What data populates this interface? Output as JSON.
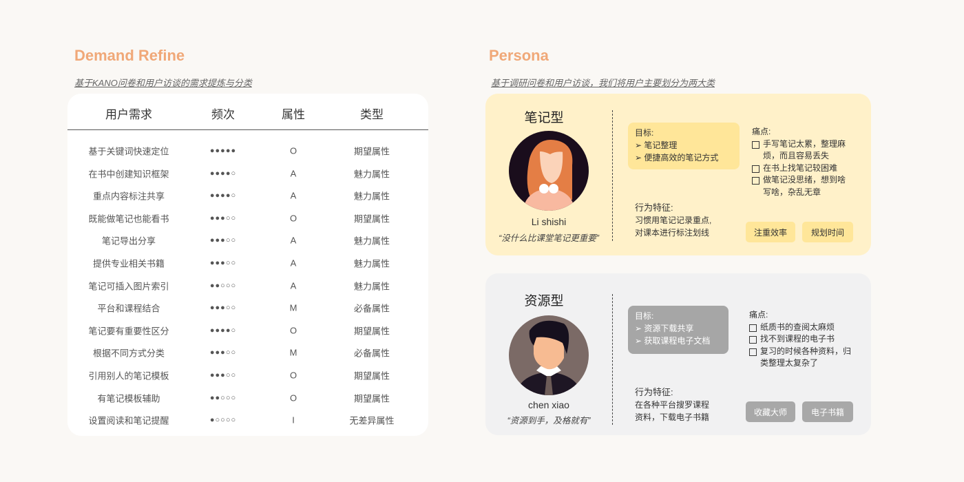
{
  "demand": {
    "title": "Demand Refine",
    "subtitle": "基于KANO问卷和用户访谈的需求提炼与分类",
    "headers": [
      "用户需求",
      "频次",
      "属性",
      "类型"
    ],
    "rows": [
      {
        "need": "基于关键词快速定位",
        "freq": "●●●●●",
        "attr": "O",
        "type": "期望属性"
      },
      {
        "need": "在书中创建知识框架",
        "freq": "●●●●○",
        "attr": "A",
        "type": "魅力属性"
      },
      {
        "need": "重点内容标注共享",
        "freq": "●●●●○",
        "attr": "A",
        "type": "魅力属性"
      },
      {
        "need": "既能做笔记也能看书",
        "freq": "●●●○○",
        "attr": "O",
        "type": "期望属性"
      },
      {
        "need": "笔记导出分享",
        "freq": "●●●○○",
        "attr": "A",
        "type": "魅力属性"
      },
      {
        "need": "提供专业相关书籍",
        "freq": "●●●○○",
        "attr": "A",
        "type": "魅力属性"
      },
      {
        "need": "笔记可插入图片索引",
        "freq": "●●○○○",
        "attr": "A",
        "type": "魅力属性"
      },
      {
        "need": "平台和课程结合",
        "freq": "●●●○○",
        "attr": "M",
        "type": "必备属性"
      },
      {
        "need": "笔记要有重要性区分",
        "freq": "●●●●○",
        "attr": "O",
        "type": "期望属性"
      },
      {
        "need": "根据不同方式分类",
        "freq": "●●●○○",
        "attr": "M",
        "type": "必备属性"
      },
      {
        "need": "引用别人的笔记模板",
        "freq": "●●●○○",
        "attr": "O",
        "type": "期望属性"
      },
      {
        "need": "有笔记模板辅助",
        "freq": "●●○○○",
        "attr": "O",
        "type": "期望属性"
      },
      {
        "need": "设置阅读和笔记提醒",
        "freq": "●○○○○",
        "attr": "I",
        "type": "无差异属性"
      }
    ]
  },
  "persona": {
    "title": "Persona",
    "subtitle": "基于调研问卷和用户访谈，我们将用户主要划分为两大类",
    "cards": [
      {
        "type": "笔记型",
        "name": "Li shishi",
        "quote": "“没什么比课堂笔记更重要”",
        "goal_label": "目标:",
        "goals": [
          "笔记整理",
          "便捷高效的笔记方式"
        ],
        "pain_label": "痛点:",
        "pains": [
          "手写笔记太累，整理麻烦，而且容易丢失",
          "在书上找笔记较困难",
          "做笔记没思绪，想到啥写啥，杂乱无章"
        ],
        "behavior_label": "行为特征:",
        "behavior": [
          "习惯用笔记记录重点,",
          "对课本进行标注划线"
        ],
        "tags": [
          "注重效率",
          "规划时间"
        ],
        "accent": "#ffe699"
      },
      {
        "type": "资源型",
        "name": "chen xiao",
        "quote": "“资源到手，及格就有”",
        "goal_label": "目标:",
        "goals": [
          "资源下载共享",
          "获取课程电子文档"
        ],
        "pain_label": "痛点:",
        "pains": [
          "纸质书的查阅太麻烦",
          "找不到课程的电子书",
          "复习的时候各种资料，归类整理太复杂了"
        ],
        "behavior_label": "行为特征:",
        "behavior": [
          "在各种平台搜罗课程",
          "资料，下载电子书籍"
        ],
        "tags": [
          "收藏大师",
          "电子书籍"
        ],
        "accent": "#a8a8a8"
      }
    ]
  }
}
